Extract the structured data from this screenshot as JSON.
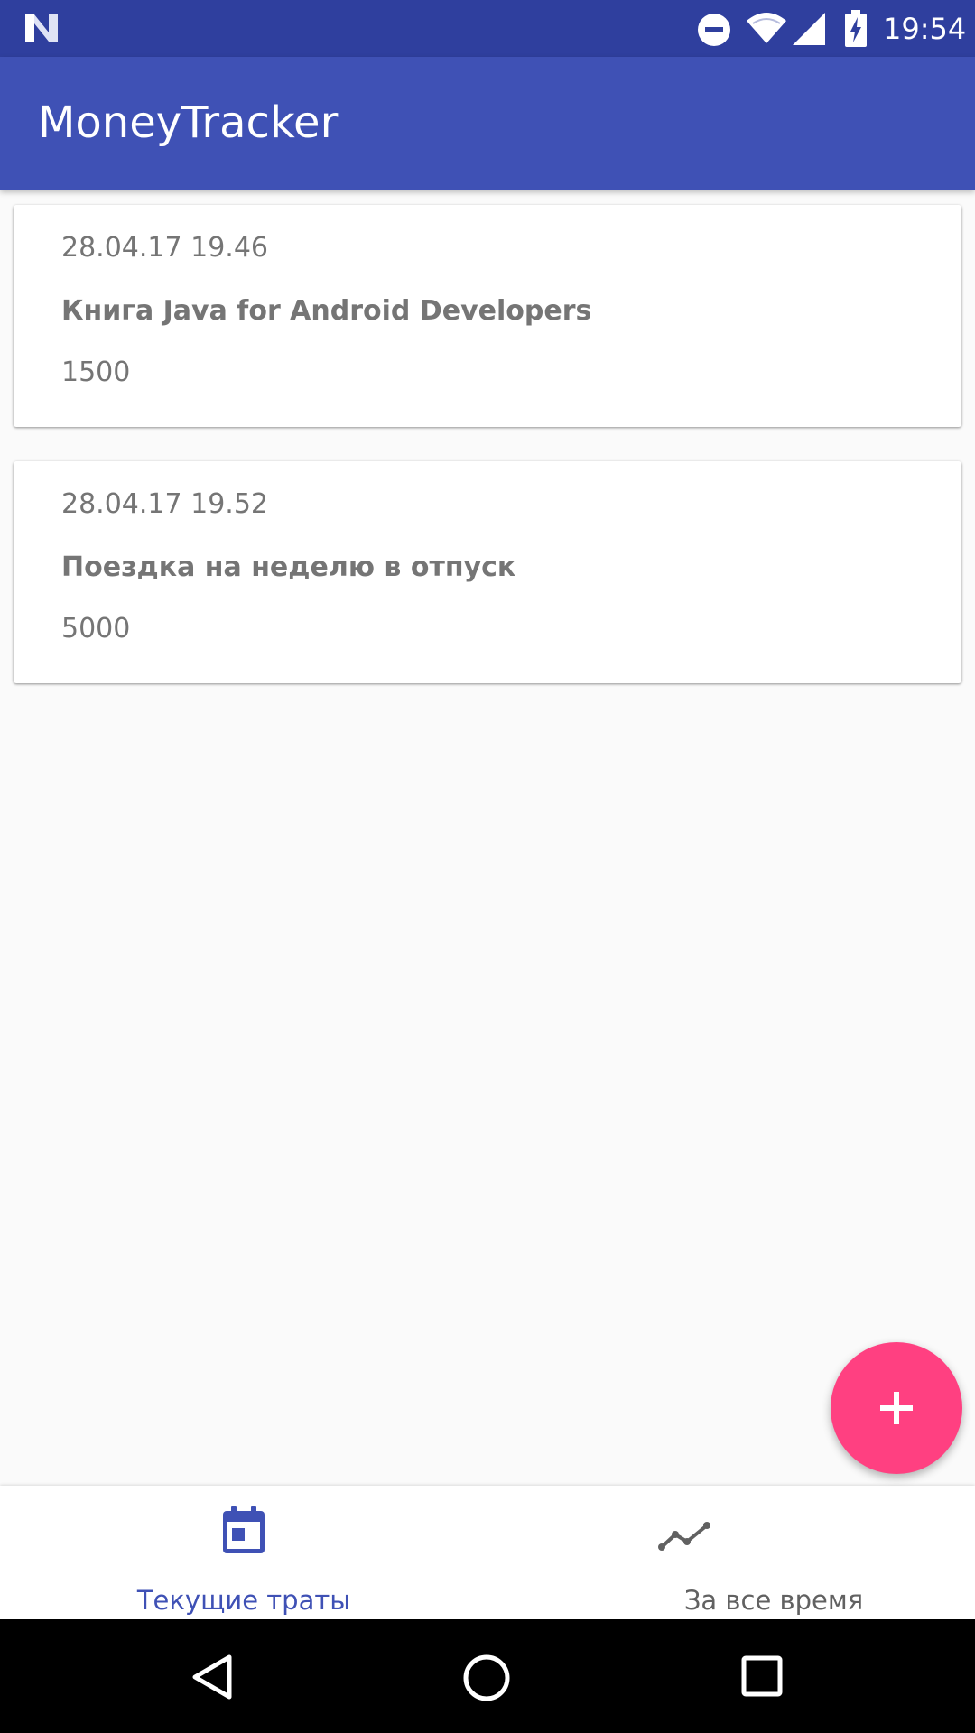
{
  "status_bar": {
    "time": "19:54",
    "icons": [
      "n-logo-icon",
      "do-not-disturb-icon",
      "wifi-icon",
      "cell-signal-icon",
      "battery-charging-icon"
    ]
  },
  "app_bar": {
    "title": "MoneyTracker"
  },
  "expenses": [
    {
      "date": "28.04.17 19.46",
      "title": "Книга Java for Android Developers",
      "amount": "1500"
    },
    {
      "date": "28.04.17 19.52",
      "title": "Поездка на неделю в отпуск",
      "amount": "5000"
    }
  ],
  "fab": {
    "icon": "plus-icon"
  },
  "bottom_nav": {
    "items": [
      {
        "label": "Текущие траты",
        "icon": "calendar-icon",
        "selected": true
      },
      {
        "label": "За все время",
        "icon": "trending-icon",
        "selected": false
      }
    ]
  },
  "system_nav": {
    "icons": [
      "back-icon",
      "home-icon",
      "recents-icon"
    ]
  },
  "colors": {
    "status_bar": "#2f3f9e",
    "primary": "#3f51b5",
    "accent": "#ff4081",
    "background": "#fafafa",
    "text_secondary": "#757575"
  }
}
